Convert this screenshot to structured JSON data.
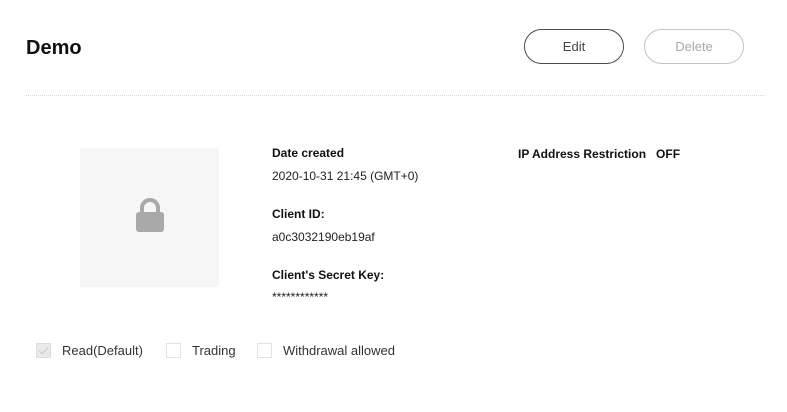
{
  "header": {
    "title": "Demo",
    "edit_label": "Edit",
    "delete_label": "Delete"
  },
  "details": {
    "image_icon": "lock-icon",
    "date_created": {
      "label": "Date created",
      "value": "2020-10-31 21:45 (GMT+0)"
    },
    "client_id": {
      "label": "Client ID:",
      "value": "a0c3032190eb19af"
    },
    "secret_key": {
      "label": "Client's Secret Key:",
      "value": "************"
    },
    "ip_restriction": {
      "label": "IP Address Restriction",
      "value": "OFF"
    }
  },
  "permissions": [
    {
      "label": "Read(Default)",
      "checked": true,
      "disabled": true
    },
    {
      "label": "Trading",
      "checked": false,
      "disabled": false
    },
    {
      "label": "Withdrawal allowed",
      "checked": false,
      "disabled": false
    }
  ],
  "colors": {
    "text": "#111111",
    "button_border": "#4a4a4a",
    "button_disabled": "#c4c4c4",
    "image_background": "#f6f6f6",
    "lock_icon": "#a9a9a9"
  }
}
